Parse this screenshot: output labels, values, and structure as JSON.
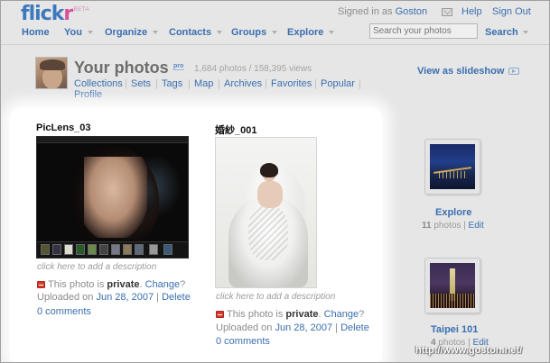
{
  "header": {
    "logo_part1": "flick",
    "logo_part2": "r",
    "logo_beta": "BETA",
    "signed_in_prefix": "Signed in as ",
    "username": "Goston",
    "help": "Help",
    "sign_out": "Sign Out"
  },
  "nav": {
    "items": [
      "Home",
      "You",
      "Organize",
      "Contacts",
      "Groups",
      "Explore"
    ],
    "search_placeholder": "Search your photos",
    "search_button": "Search"
  },
  "profile": {
    "title": "Your photos",
    "pro_badge": "pro",
    "stats": "1,684 photos / 158,395 views",
    "subnav": [
      "Collections",
      "Sets",
      "Tags",
      "Map",
      "Archives",
      "Favorites",
      "Popular",
      "Profile"
    ],
    "slideshow": "View as slideshow"
  },
  "photos": [
    {
      "title": "PicLens_03",
      "description": "click here to add a description",
      "privacy_prefix": "This photo is ",
      "privacy": "private",
      "change": "Change",
      "question": "?",
      "uploaded_prefix": "Uploaded on ",
      "date": "Jun 28, 2007",
      "delete": "Delete",
      "comments": "0 comments"
    },
    {
      "title": "婚紗_001",
      "description": "click here to add a description",
      "privacy_prefix": "This photo is ",
      "privacy": "private",
      "change": "Change",
      "question": "?",
      "uploaded_prefix": "Uploaded on ",
      "date": "Jun 28, 2007",
      "delete": "Delete",
      "comments": "0 comments"
    }
  ],
  "sets": [
    {
      "name": "Explore",
      "count": "11",
      "photos_label": " photos | ",
      "edit": "Edit"
    },
    {
      "name": "Taipei 101",
      "count": "4",
      "photos_label": " photos | ",
      "edit": "Edit"
    }
  ],
  "watermark": "http://www.goston.net/",
  "colors": {
    "link_blue": "#3a6fb0",
    "logo_pink": "#d8529a",
    "private_red": "#d63a2c"
  }
}
